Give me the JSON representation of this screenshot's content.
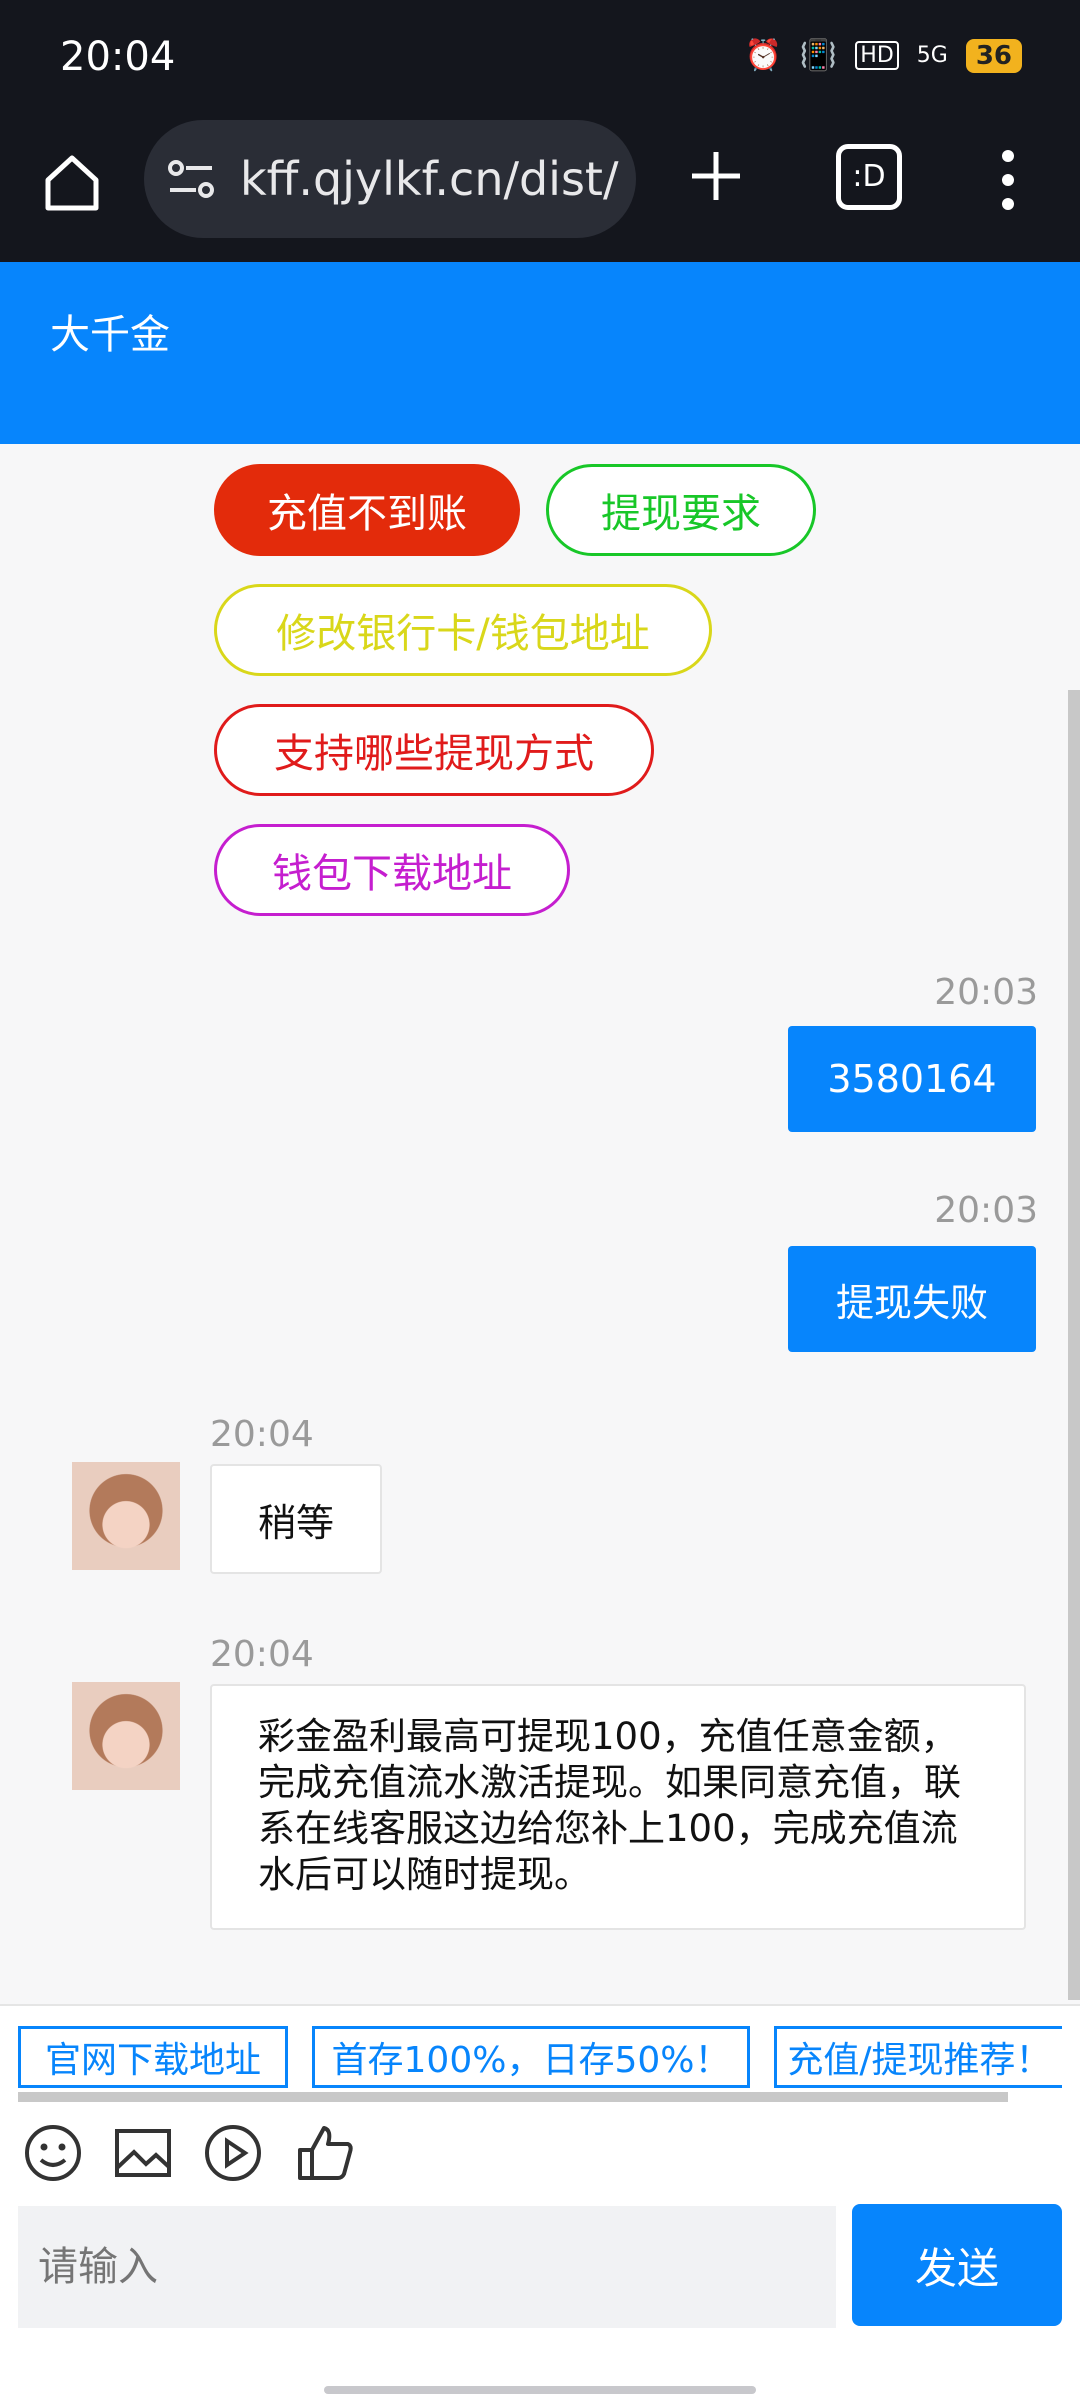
{
  "status": {
    "time": "20:04",
    "battery": "36",
    "network": "5G",
    "hd": "HD"
  },
  "browser": {
    "url": "kff.qjylkf.cn/dist/c",
    "tabs_label": ":D"
  },
  "header": {
    "title": "大千金"
  },
  "quick_buttons": [
    {
      "label": "充值不到账",
      "color": "#e32b0b",
      "style": "filled"
    },
    {
      "label": "提现要求",
      "color": "#18c728",
      "style": "outline"
    },
    {
      "label": "修改银行卡/钱包地址",
      "color": "#d9d71a",
      "style": "outline"
    },
    {
      "label": "支持哪些提现方式",
      "color": "#e01b1b",
      "style": "outline"
    },
    {
      "label": "钱包下载地址",
      "color": "#c51ecf",
      "style": "outline"
    }
  ],
  "messages": [
    {
      "from": "me",
      "time": "20:03",
      "text": "3580164"
    },
    {
      "from": "me",
      "time": "20:03",
      "text": "提现失败"
    },
    {
      "from": "bot",
      "time": "20:04",
      "text": "稍等"
    },
    {
      "from": "bot",
      "time": "20:04",
      "text": "彩金盈利最高可提现100，充值任意金额，完成充值流水激活提现。如果同意充值，联系在线客服这边给您补上100，完成充值流水后可以随时提现。"
    }
  ],
  "links": [
    "官网下载地址",
    "首存100%，日存50%！",
    "充值/提现推荐！"
  ],
  "input": {
    "placeholder": "请输入",
    "send_label": "发送"
  }
}
